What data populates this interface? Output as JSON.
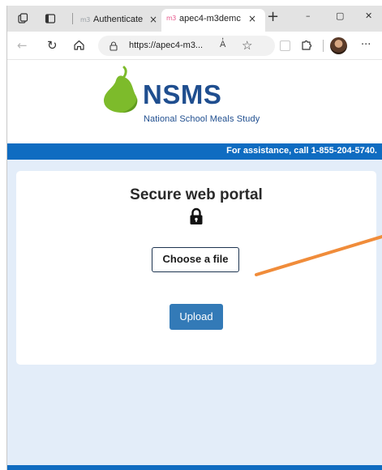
{
  "browser": {
    "tabs": [
      {
        "favicon": "m3",
        "title": "Authenticate",
        "close": "×"
      },
      {
        "favicon": "m3",
        "title": "apec4-m3demc",
        "close": "×"
      }
    ],
    "new_tab": "+",
    "window_controls": {
      "minimize": "–",
      "maximize": "▢",
      "close": "✕"
    },
    "address": {
      "url": "https://apec4-m3...",
      "read_aloud": "A̓",
      "favorite_glyph": "☆"
    },
    "icons": [
      "workspaces-icon",
      "tab-actions-icon",
      "back-icon",
      "refresh-icon",
      "home-icon",
      "lock-icon",
      "read-aloud-icon",
      "favorite-star-icon",
      "extensions-icon",
      "profile-avatar",
      "more-menu-icon"
    ],
    "more_glyph": "···"
  },
  "site": {
    "logo_text": "NSMS",
    "logo_subtitle": "National School Meals Study",
    "assistance": "For assistance, call 1-855-204-5740."
  },
  "portal": {
    "title": "Secure web portal",
    "choose_file_label": "Choose a file",
    "upload_label": "Upload"
  },
  "colors": {
    "brand_blue": "#0f6cc1",
    "logo_blue": "#1f4e8f",
    "pear_green": "#7dbb2b",
    "upload_blue": "#337ab7",
    "page_bg": "#e3edf9",
    "annotation_arrow": "#f08c3a"
  }
}
